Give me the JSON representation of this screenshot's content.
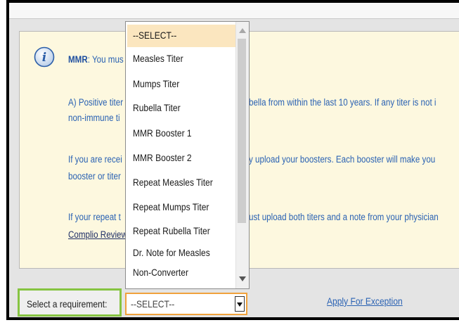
{
  "notice": {
    "title_bold": "MMR",
    "line1": ": You mus",
    "line2a": "A) Positive titer",
    "line2b": "bella from within the last 10 years.  If any titer is not i",
    "line3": "non-immune ti",
    "line4a": "If you are recei",
    "line4b": "y upload your boosters.  Each booster will make you",
    "line5": "booster or titer",
    "line6a": "If your repeat t",
    "line6b": "ust upload both titers and a note from your physician",
    "line7_link": "Complio Review"
  },
  "dropdown": {
    "options": [
      "--SELECT--",
      "Measles Titer",
      "Mumps Titer",
      "Rubella Titer",
      "MMR Booster 1",
      "MMR Booster 2",
      "Repeat Measles Titer",
      "Repeat Mumps Titer",
      "Repeat Rubella Titer",
      "Dr. Note for Measles",
      "Non-Converter"
    ],
    "selected_index": 0
  },
  "bottom": {
    "req_label": "Select a requirement:",
    "select_value": "--SELECT--",
    "apply_link": "Apply For Exception"
  },
  "colors": {
    "highlight_border": "#86c441",
    "select_border": "#f0a23c",
    "notice_bg": "#fdf8df",
    "link_blue": "#2a62b3"
  },
  "icons": {
    "info": "info-icon"
  }
}
